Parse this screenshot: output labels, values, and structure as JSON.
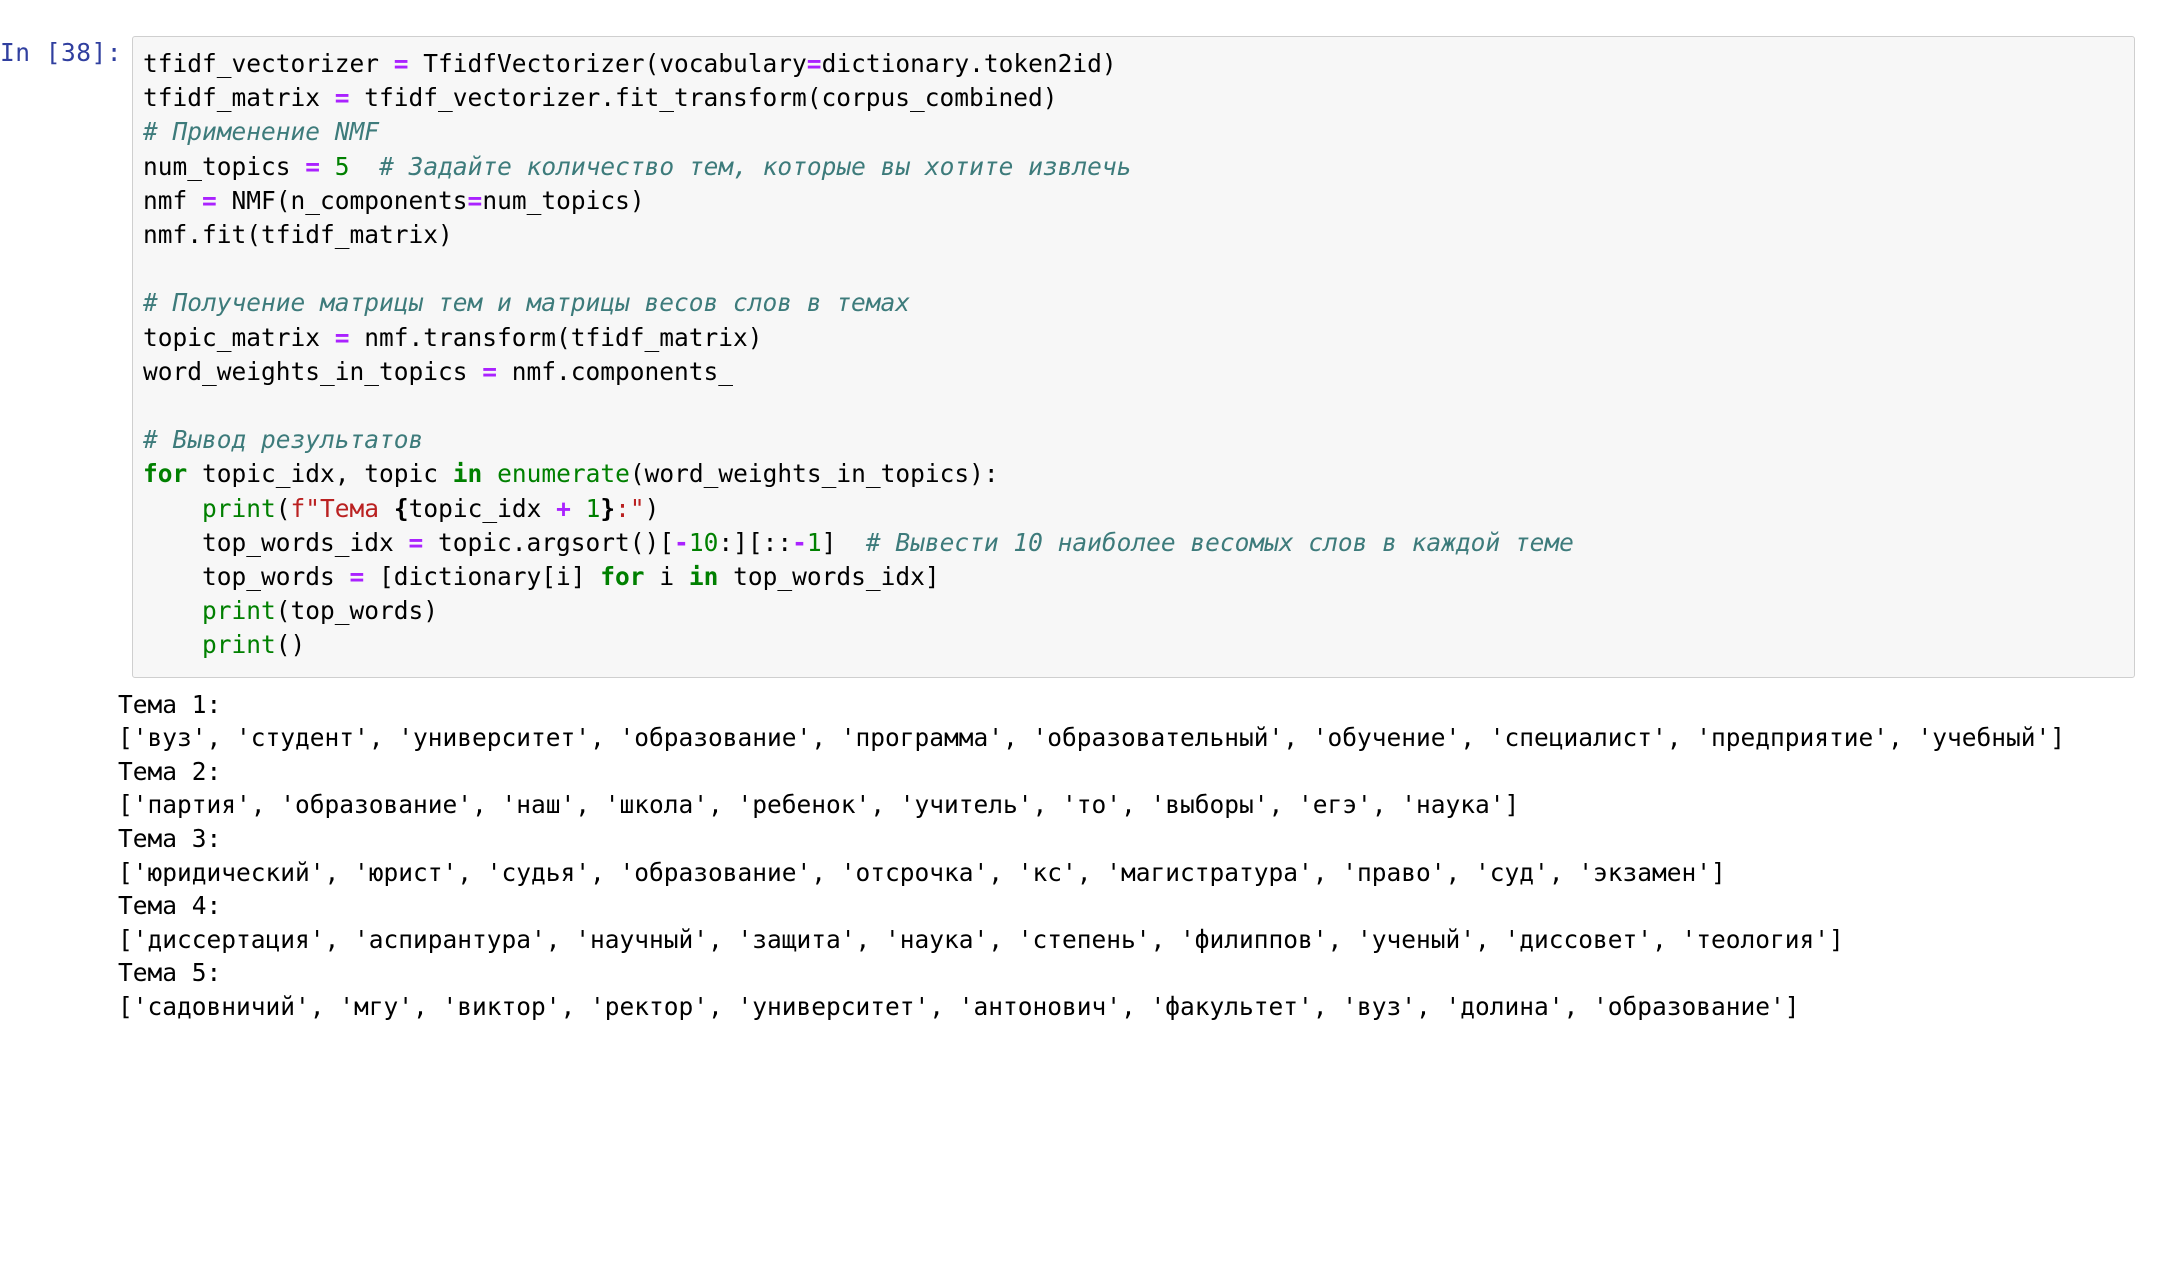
{
  "cell": {
    "prompt": "In [38]:",
    "code_lines": [
      {
        "id": "line-1",
        "tokens": [
          {
            "t": "tfidf_vectorizer ",
            "c": "plain"
          },
          {
            "t": "=",
            "c": "op"
          },
          {
            "t": " TfidfVectorizer(vocabulary",
            "c": "plain"
          },
          {
            "t": "=",
            "c": "op"
          },
          {
            "t": "dictionary.token2id)",
            "c": "plain"
          }
        ]
      },
      {
        "id": "line-2",
        "tokens": [
          {
            "t": "tfidf_matrix ",
            "c": "plain"
          },
          {
            "t": "=",
            "c": "op"
          },
          {
            "t": " tfidf_vectorizer.fit_transform(corpus_combined)",
            "c": "plain"
          }
        ]
      },
      {
        "id": "line-3",
        "tokens": [
          {
            "t": "# Применение NMF",
            "c": "comment"
          }
        ]
      },
      {
        "id": "line-4",
        "tokens": [
          {
            "t": "num_topics ",
            "c": "plain"
          },
          {
            "t": "=",
            "c": "op"
          },
          {
            "t": " ",
            "c": "plain"
          },
          {
            "t": "5",
            "c": "number"
          },
          {
            "t": "  ",
            "c": "plain"
          },
          {
            "t": "# Задайте количество тем, которые вы хотите извлечь",
            "c": "comment"
          }
        ]
      },
      {
        "id": "line-5",
        "tokens": [
          {
            "t": "nmf ",
            "c": "plain"
          },
          {
            "t": "=",
            "c": "op"
          },
          {
            "t": " NMF(n_components",
            "c": "plain"
          },
          {
            "t": "=",
            "c": "op"
          },
          {
            "t": "num_topics)",
            "c": "plain"
          }
        ]
      },
      {
        "id": "line-6",
        "tokens": [
          {
            "t": "nmf.fit(tfidf_matrix)",
            "c": "plain"
          }
        ]
      },
      {
        "id": "line-7",
        "tokens": [
          {
            "t": "",
            "c": "plain"
          }
        ]
      },
      {
        "id": "line-8",
        "tokens": [
          {
            "t": "# Получение матрицы тем и матрицы весов слов в темах",
            "c": "comment"
          }
        ]
      },
      {
        "id": "line-9",
        "tokens": [
          {
            "t": "topic_matrix ",
            "c": "plain"
          },
          {
            "t": "=",
            "c": "op"
          },
          {
            "t": " nmf.transform(tfidf_matrix)",
            "c": "plain"
          }
        ]
      },
      {
        "id": "line-10",
        "tokens": [
          {
            "t": "word_weights_in_topics ",
            "c": "plain"
          },
          {
            "t": "=",
            "c": "op"
          },
          {
            "t": " nmf.components_",
            "c": "plain"
          }
        ]
      },
      {
        "id": "line-11",
        "tokens": [
          {
            "t": "",
            "c": "plain"
          }
        ]
      },
      {
        "id": "line-12",
        "tokens": [
          {
            "t": "# Вывод результатов",
            "c": "comment"
          }
        ]
      },
      {
        "id": "line-13",
        "tokens": [
          {
            "t": "for",
            "c": "keyword"
          },
          {
            "t": " topic_idx, topic ",
            "c": "plain"
          },
          {
            "t": "in",
            "c": "keyword"
          },
          {
            "t": " ",
            "c": "plain"
          },
          {
            "t": "enumerate",
            "c": "builtin"
          },
          {
            "t": "(word_weights_in_topics):",
            "c": "plain"
          }
        ]
      },
      {
        "id": "line-14",
        "tokens": [
          {
            "t": "    ",
            "c": "plain"
          },
          {
            "t": "print",
            "c": "builtin"
          },
          {
            "t": "(",
            "c": "plain"
          },
          {
            "t": "f\"Тема ",
            "c": "string"
          },
          {
            "t": "{",
            "c": "fstring-brace"
          },
          {
            "t": "topic_idx ",
            "c": "plain"
          },
          {
            "t": "+",
            "c": "op"
          },
          {
            "t": " ",
            "c": "plain"
          },
          {
            "t": "1",
            "c": "number"
          },
          {
            "t": "}",
            "c": "fstring-brace"
          },
          {
            "t": ":\"",
            "c": "string"
          },
          {
            "t": ")",
            "c": "plain"
          }
        ]
      },
      {
        "id": "line-15",
        "tokens": [
          {
            "t": "    top_words_idx ",
            "c": "plain"
          },
          {
            "t": "=",
            "c": "op"
          },
          {
            "t": " topic.argsort()[",
            "c": "plain"
          },
          {
            "t": "-",
            "c": "op"
          },
          {
            "t": "10",
            "c": "number"
          },
          {
            "t": ":][::",
            "c": "plain"
          },
          {
            "t": "-",
            "c": "op"
          },
          {
            "t": "1",
            "c": "number"
          },
          {
            "t": "]  ",
            "c": "plain"
          },
          {
            "t": "# Вывести 10 наиболее весомых слов в каждой теме",
            "c": "comment"
          }
        ]
      },
      {
        "id": "line-16",
        "tokens": [
          {
            "t": "    top_words ",
            "c": "plain"
          },
          {
            "t": "=",
            "c": "op"
          },
          {
            "t": " [dictionary[i] ",
            "c": "plain"
          },
          {
            "t": "for",
            "c": "keyword"
          },
          {
            "t": " i ",
            "c": "plain"
          },
          {
            "t": "in",
            "c": "keyword"
          },
          {
            "t": " top_words_idx]",
            "c": "plain"
          }
        ]
      },
      {
        "id": "line-17",
        "tokens": [
          {
            "t": "    ",
            "c": "plain"
          },
          {
            "t": "print",
            "c": "builtin"
          },
          {
            "t": "(top_words)",
            "c": "plain"
          }
        ]
      },
      {
        "id": "line-18",
        "tokens": [
          {
            "t": "    ",
            "c": "plain"
          },
          {
            "t": "print",
            "c": "builtin"
          },
          {
            "t": "()",
            "c": "plain"
          }
        ]
      }
    ]
  },
  "output": {
    "topics": [
      {
        "title": "Тема 1:",
        "words_text": "['вуз', 'студент', 'университет', 'образование', 'программа', 'образовательный', 'обучение', 'специалист', 'предприятие', 'учебный']",
        "words": [
          "вуз",
          "студент",
          "университет",
          "образование",
          "программа",
          "образовательный",
          "обучение",
          "специалист",
          "предприятие",
          "учебный"
        ]
      },
      {
        "title": "Тема 2:",
        "words_text": "['партия', 'образование', 'наш', 'школа', 'ребенок', 'учитель', 'то', 'выборы', 'егэ', 'наука']",
        "words": [
          "партия",
          "образование",
          "наш",
          "школа",
          "ребенок",
          "учитель",
          "то",
          "выборы",
          "егэ",
          "наука"
        ]
      },
      {
        "title": "Тема 3:",
        "words_text": "['юридический', 'юрист', 'судья', 'образование', 'отсрочка', 'кс', 'магистратура', 'право', 'суд', 'экзамен']",
        "words": [
          "юридический",
          "юрист",
          "судья",
          "образование",
          "отсрочка",
          "кс",
          "магистратура",
          "право",
          "суд",
          "экзамен"
        ]
      },
      {
        "title": "Тема 4:",
        "words_text": "['диссертация', 'аспирантура', 'научный', 'защита', 'наука', 'степень', 'филиппов', 'ученый', 'диссовет', 'теология']",
        "words": [
          "диссертация",
          "аспирантура",
          "научный",
          "защита",
          "наука",
          "степень",
          "филиппов",
          "ученый",
          "диссовет",
          "теология"
        ]
      },
      {
        "title": "Тема 5:",
        "words_text": "['садовничий', 'мгу', 'виктор', 'ректор', 'университет', 'антонович', 'факультет', 'вуз', 'долина', 'образование']",
        "words": [
          "садовничий",
          "мгу",
          "виктор",
          "ректор",
          "университет",
          "антонович",
          "факультет",
          "вуз",
          "долина",
          "образование"
        ]
      }
    ]
  },
  "colors": {
    "prompt": "#303F9F",
    "comment": "#3D7B7B",
    "keyword": "#008000",
    "builtin": "#008000",
    "operator": "#AA22FF",
    "number": "#008000",
    "string": "#BA2121",
    "cell_background": "#f7f7f7",
    "cell_border": "#cfcfcf",
    "text": "#000000"
  }
}
